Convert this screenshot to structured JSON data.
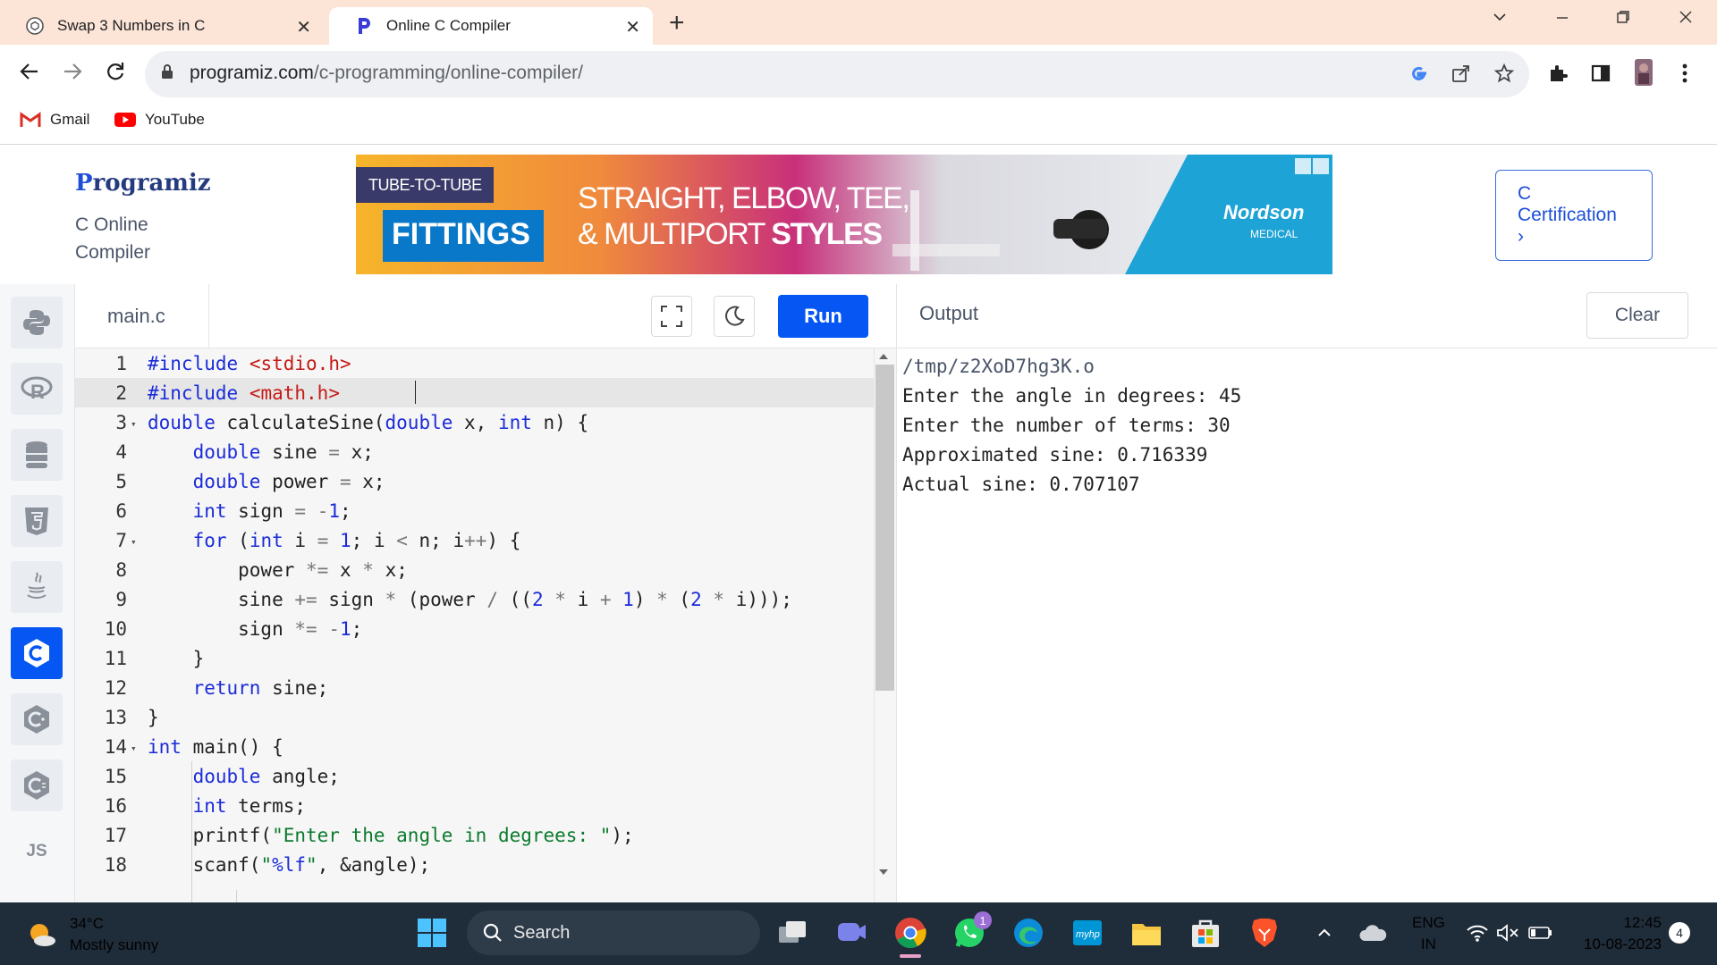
{
  "browser": {
    "tabs": [
      {
        "title": "Swap 3 Numbers in C",
        "active": false,
        "icon": "chatgpt-icon"
      },
      {
        "title": "Online C Compiler",
        "active": true,
        "icon": "programiz-icon"
      }
    ],
    "url_domain": "programiz.com",
    "url_path": "/c-programming/online-compiler/",
    "bookmarks": [
      {
        "label": "Gmail",
        "icon": "gmail-icon"
      },
      {
        "label": "YouTube",
        "icon": "youtube-icon"
      }
    ]
  },
  "header": {
    "logo_first": "P",
    "logo_rest": "rogramiz",
    "subtitle_line1": "C Online",
    "subtitle_line2": "Compiler",
    "certification": {
      "line1": "C",
      "line2": "Certification",
      "arrow": "›"
    }
  },
  "ad": {
    "tag": "TUBE-TO-TUBE",
    "headline": "FITTINGS",
    "line1": "STRAIGHT, ELBOW, TEE,",
    "line2_a": "& MULTIPORT ",
    "line2_b": "STYLES",
    "brand": "Nordson",
    "brand_sub": "MEDICAL"
  },
  "editor": {
    "filename": "main.c",
    "run_label": "Run",
    "sidebar_languages": [
      "python",
      "r",
      "sql",
      "html",
      "java",
      "c",
      "cpp",
      "csharp",
      "js"
    ],
    "active_language": "c",
    "js_label": "JS",
    "line_numbers": [
      "1",
      "2",
      "3",
      "4",
      "5",
      "6",
      "7",
      "8",
      "9",
      "10",
      "11",
      "12",
      "13",
      "14",
      "15",
      "16",
      "17",
      "18"
    ],
    "code_lines": [
      "#include <stdio.h>",
      "#include <math.h>",
      "double calculateSine(double x, int n) {",
      "    double sine = x;",
      "    double power = x;",
      "    int sign = -1;",
      "    for (int i = 1; i < n; i++) {",
      "        power *= x * x;",
      "        sine += sign * (power / ((2 * i + 1) * (2 * i)));",
      "        sign *= -1;",
      "    }",
      "    return sine;",
      "}",
      "int main() {",
      "    double angle;",
      "    int terms;",
      "    printf(\"Enter the angle in degrees: \");",
      "    scanf(\"%lf\", &angle);"
    ]
  },
  "output": {
    "title": "Output",
    "clear_label": "Clear",
    "lines": [
      "/tmp/z2XoD7hg3K.o",
      "Enter the angle in degrees: 45",
      "Enter the number of terms: 30",
      "Approximated sine: 0.716339",
      "Actual sine: 0.707107"
    ]
  },
  "taskbar": {
    "temperature": "34°C",
    "weather": "Mostly sunny",
    "search_placeholder": "Search",
    "whatsapp_badge": "1",
    "lang_line1": "ENG",
    "lang_line2": "IN",
    "time": "12:45",
    "date": "10-08-2023",
    "notification_count": "4"
  }
}
